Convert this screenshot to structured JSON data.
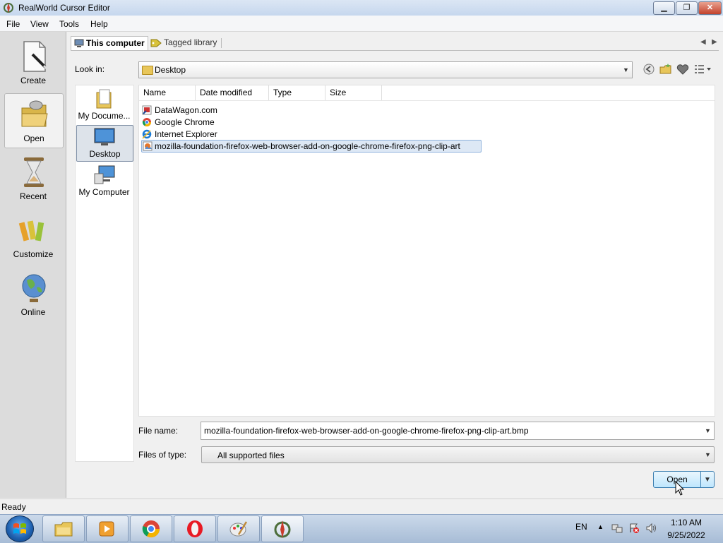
{
  "window": {
    "title": "RealWorld Cursor Editor",
    "icon": "realworld-app-icon"
  },
  "window_controls": {
    "minimize": "▁",
    "restore": "❐",
    "close": "✕"
  },
  "menu": [
    "File",
    "View",
    "Tools",
    "Help"
  ],
  "left_pane": [
    {
      "label": "Create",
      "icon": "create-document-icon"
    },
    {
      "label": "Open",
      "icon": "open-folder-icon",
      "active": true
    },
    {
      "label": "Recent",
      "icon": "hourglass-icon"
    },
    {
      "label": "Customize",
      "icon": "crayons-icon"
    },
    {
      "label": "Online",
      "icon": "globe-icon"
    }
  ],
  "tabs": [
    {
      "label": "This computer",
      "icon": "computer-icon",
      "active": true
    },
    {
      "label": "Tagged library",
      "icon": "tag-icon"
    }
  ],
  "tab_scroll": {
    "left": "◀",
    "right": "▶"
  },
  "look_in": {
    "label": "Look in:",
    "value": "Desktop"
  },
  "toolbar_icons": [
    "back-icon",
    "new-folder-icon",
    "favorites-icon",
    "view-menu-icon"
  ],
  "places": [
    {
      "label": "My Docume...",
      "icon": "my-documents-icon"
    },
    {
      "label": "Desktop",
      "icon": "desktop-icon",
      "selected": true
    },
    {
      "label": "My Computer",
      "icon": "my-computer-icon"
    }
  ],
  "columns": [
    "Name",
    "Date modified",
    "Type",
    "Size"
  ],
  "files": [
    {
      "name": "DataWagon.com",
      "icon": "shortcut-icon"
    },
    {
      "name": "Google Chrome",
      "icon": "chrome-shortcut-icon"
    },
    {
      "name": "Internet Explorer",
      "icon": "ie-shortcut-icon"
    },
    {
      "name": "mozilla-foundation-firefox-web-browser-add-on-google-chrome-firefox-png-clip-art",
      "icon": "image-file-icon",
      "selected": true
    }
  ],
  "file_name": {
    "label": "File name:",
    "value": "mozilla-foundation-firefox-web-browser-add-on-google-chrome-firefox-png-clip-art.bmp"
  },
  "file_type": {
    "label": "Files of type:",
    "value": "All supported files"
  },
  "open_button": {
    "label": "Open"
  },
  "status": "Ready",
  "taskbar": {
    "items": [
      "file-explorer-icon",
      "media-player-icon",
      "chrome-icon",
      "opera-icon",
      "paint-icon",
      "cursor-editor-icon"
    ],
    "language": "EN",
    "time": "1:10 AM",
    "date": "9/25/2022"
  }
}
